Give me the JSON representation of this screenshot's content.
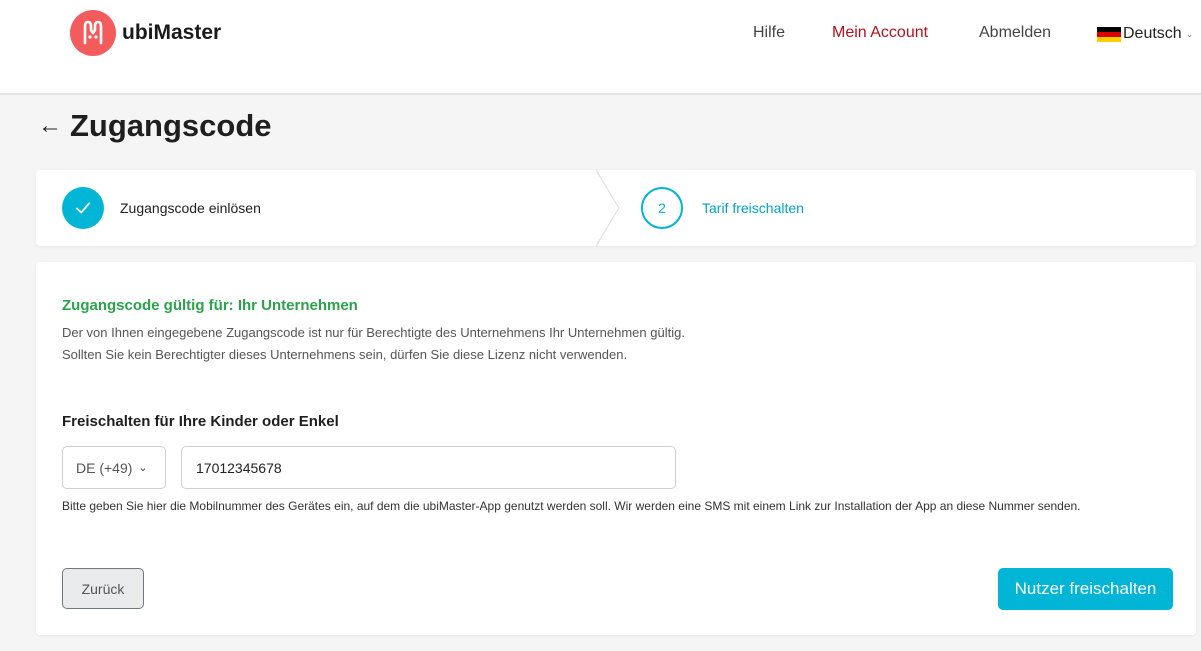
{
  "brand": {
    "name": "ubiMaster",
    "color": "#f25c5c"
  },
  "nav": {
    "help": "Hilfe",
    "account": "Mein Account",
    "logout": "Abmelden",
    "language": "Deutsch",
    "language_flag": "germany-flag-icon"
  },
  "page": {
    "title": "Zugangscode",
    "back_icon": "arrow-left-icon"
  },
  "stepper": {
    "steps": [
      {
        "label": "Zugangscode einlösen",
        "status": "completed",
        "icon": "check-icon"
      },
      {
        "label": "Tarif freischalten",
        "number": "2",
        "status": "active"
      }
    ]
  },
  "validity": {
    "title": "Zugangscode gültig für: Ihr Unternehmen",
    "line1": "Der von Ihnen eingegebene Zugangscode ist nur für Berechtigte des Unternehmens Ihr Unternehmen gültig.",
    "line2": "Sollten Sie kein Berechtigter dieses Unternehmens sein, dürfen Sie diese Lizenz nicht verwenden."
  },
  "unlock": {
    "section_title": "Freischalten für Ihre Kinder oder Enkel",
    "country_code": "DE (+49)",
    "phone_value": "17012345678",
    "hint": "Bitte geben Sie hier die Mobilnummer des Gerätes ein, auf dem die ubiMaster-App genutzt werden soll. Wir werden eine SMS mit einem Link zur Installation der App an diese Nummer senden."
  },
  "actions": {
    "back_label": "Zurück",
    "submit_label": "Nutzer freischalten"
  },
  "colors": {
    "accent": "#00b5d6",
    "success": "#2aa34a",
    "account_link": "#b3121c"
  }
}
